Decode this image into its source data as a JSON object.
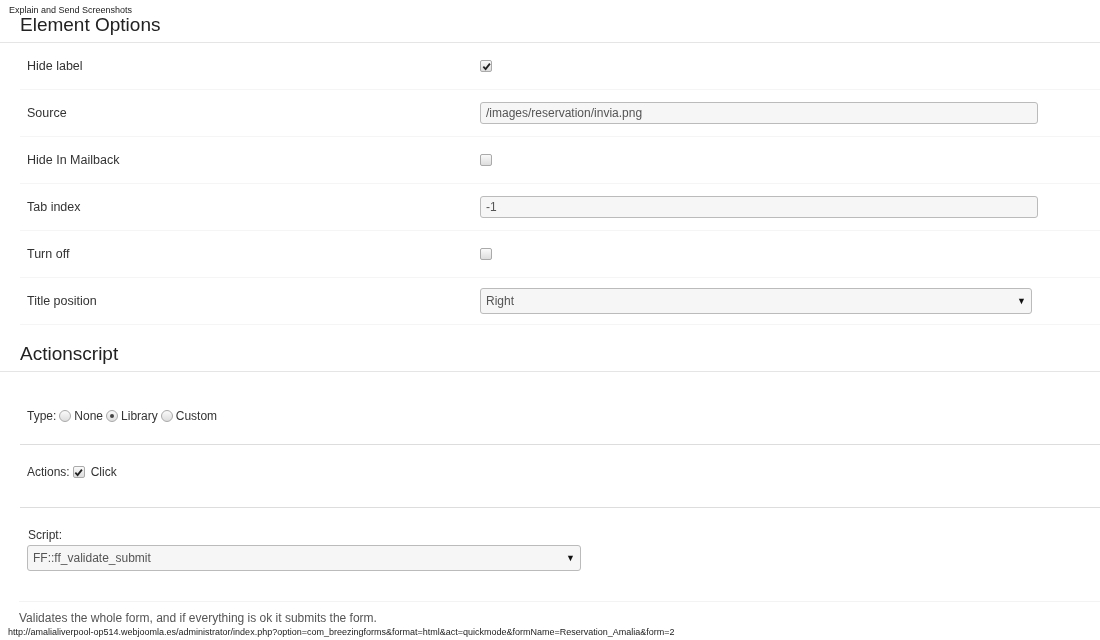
{
  "top_link": "Explain and Send Screenshots",
  "element_options": {
    "title": "Element Options",
    "rows": [
      {
        "kind": "checkbox",
        "label": "Hide label",
        "checked": true
      },
      {
        "kind": "text",
        "label": "Source",
        "value": "/images/reservation/invia.png"
      },
      {
        "kind": "checkbox",
        "label": "Hide In Mailback",
        "checked": false
      },
      {
        "kind": "text",
        "label": "Tab index",
        "value": "-1"
      },
      {
        "kind": "checkbox",
        "label": "Turn off",
        "checked": false
      },
      {
        "kind": "select",
        "label": "Title position",
        "value": "Right",
        "caret": "▼"
      }
    ]
  },
  "actionscript": {
    "title": "Actionscript",
    "type": {
      "label": "Type:",
      "options": [
        {
          "label": "None",
          "selected": false
        },
        {
          "label": "Library",
          "selected": true
        },
        {
          "label": "Custom",
          "selected": false
        }
      ]
    },
    "actions": {
      "label": "Actions:",
      "items": [
        {
          "label": "Click",
          "checked": true
        }
      ]
    },
    "script": {
      "label": "Script:",
      "value": "FF::ff_validate_submit",
      "caret": "▼"
    },
    "description": "Validates the whole form, and if everything is ok it submits the form."
  },
  "status_url": "http://amalialiverpool-op514.webjoomla.es/administrator/index.php?option=com_breezingforms&format=html&act=quickmode&formName=Reservation_Amalia&form=2"
}
